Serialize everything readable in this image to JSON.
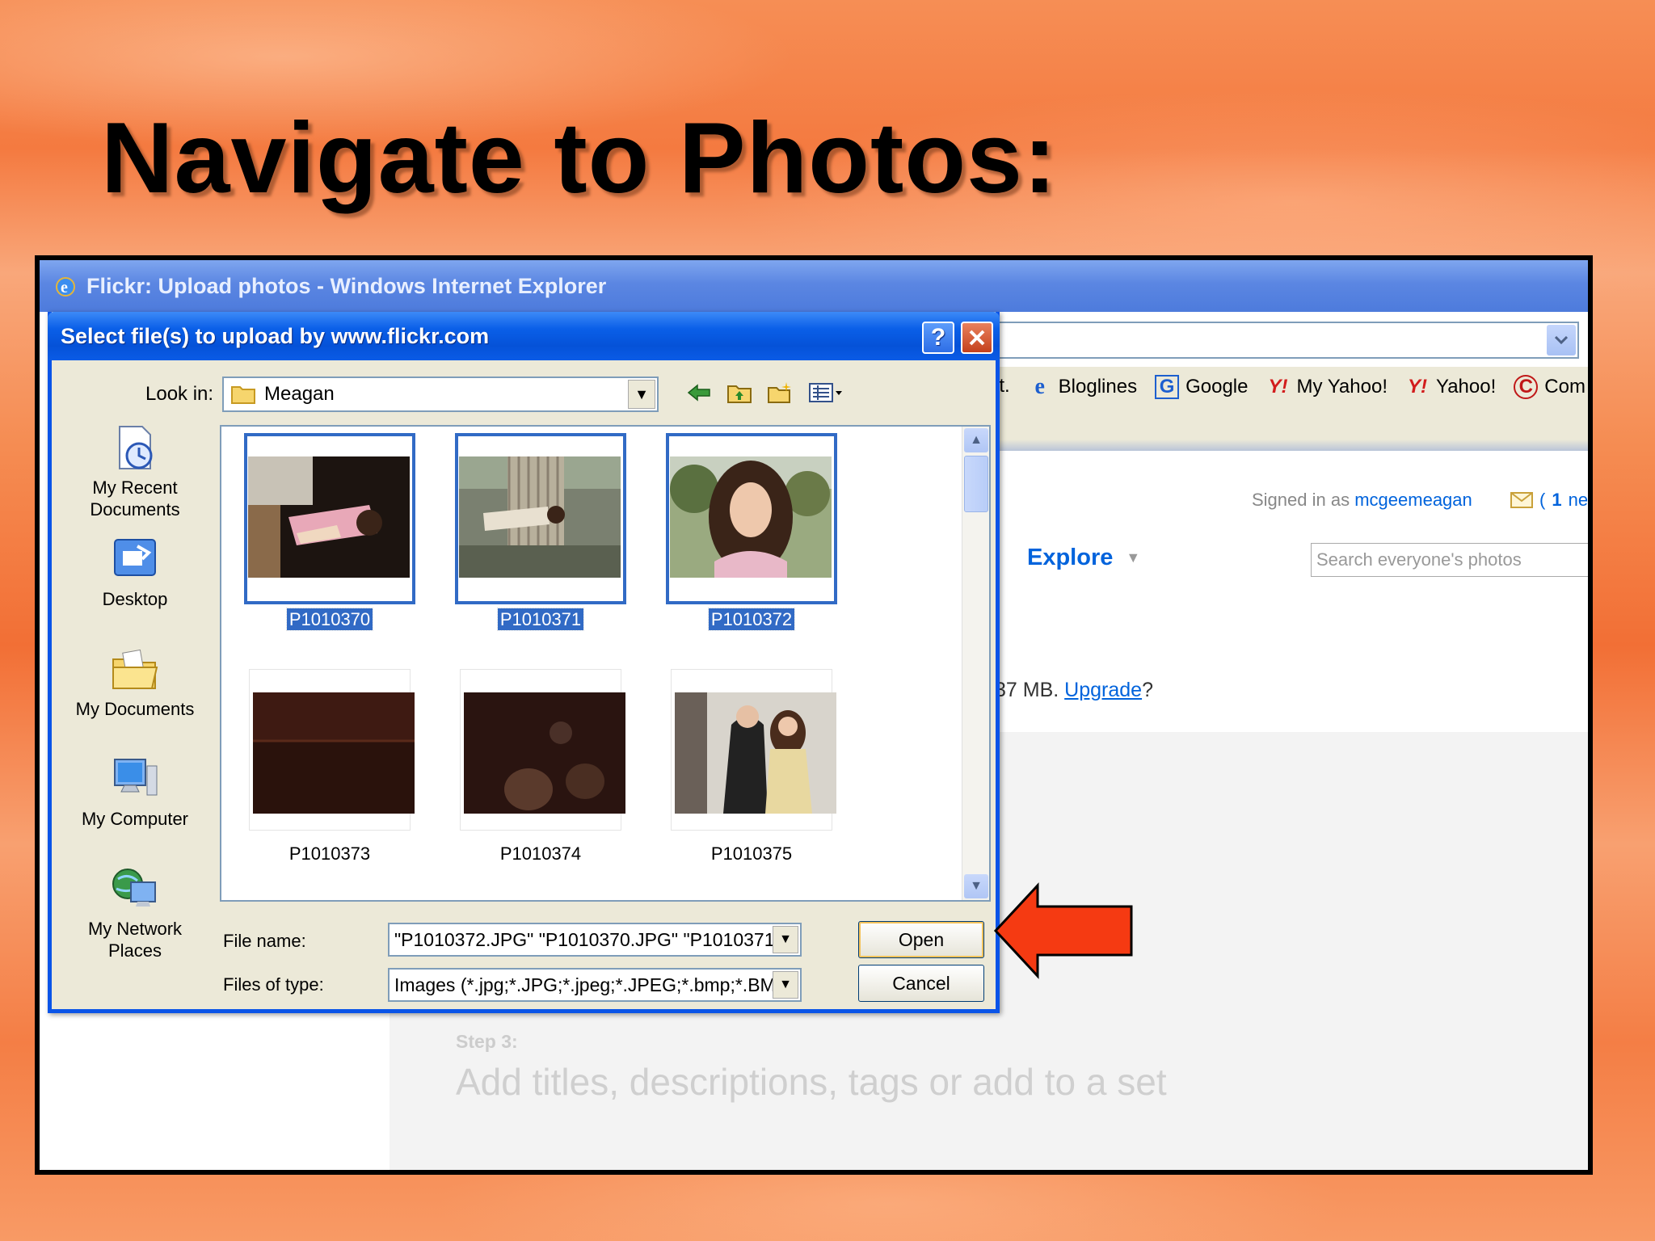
{
  "slide": {
    "title": "Navigate to Photos:"
  },
  "ie": {
    "window_title": "Flickr: Upload photos - Windows Internet Explorer",
    "links": [
      {
        "label": "it.",
        "icon": "partial-link-icon"
      },
      {
        "label": "Bloglines",
        "icon": "ie-page-icon"
      },
      {
        "label": "Google",
        "icon": "google-icon"
      },
      {
        "label": "My Yahoo!",
        "icon": "yahoo-icon"
      },
      {
        "label": "Yahoo!",
        "icon": "yahoo-icon"
      },
      {
        "label": "Com",
        "icon": "c-icon"
      }
    ]
  },
  "flickr": {
    "signed_in_prefix": "Signed in as",
    "username": "mcgeemeagan",
    "mail_count": "1",
    "mail_suffix": "new",
    "mail_open": "(",
    "mail_close": ")",
    "explore": "Explore",
    "search_placeholder": "Search everyone's photos",
    "quota_prefix": "37 MB.",
    "upgrade": "Upgrade",
    "quota_suffix": "?",
    "step3_label": "Step 3:",
    "step3_text": "Add titles, descriptions, tags or add to a set"
  },
  "dialog": {
    "title": "Select file(s) to upload by www.flickr.com",
    "help": "?",
    "close": "✕",
    "look_in_label": "Look in:",
    "look_in_value": "Meagan",
    "places": [
      "My Recent\nDocuments",
      "Desktop",
      "My Documents",
      "My Computer",
      "My Network\nPlaces"
    ],
    "files": [
      {
        "name": "P1010370",
        "selected": true
      },
      {
        "name": "P1010371",
        "selected": true
      },
      {
        "name": "P1010372",
        "selected": true
      },
      {
        "name": "P1010373",
        "selected": false
      },
      {
        "name": "P1010374",
        "selected": false
      },
      {
        "name": "P1010375",
        "selected": false
      }
    ],
    "file_name_label": "File name:",
    "file_name_value": "\"P1010372.JPG\" \"P1010370.JPG\" \"P1010371",
    "file_type_label": "Files of type:",
    "file_type_value": "Images (*.jpg;*.JPG;*.jpeg;*.JPEG;*.bmp;*.BMP",
    "open": "Open",
    "cancel": "Cancel"
  },
  "colors": {
    "dialog_blue": "#0a54e8",
    "selection": "#316ac5",
    "arrow": "#f53a12"
  }
}
